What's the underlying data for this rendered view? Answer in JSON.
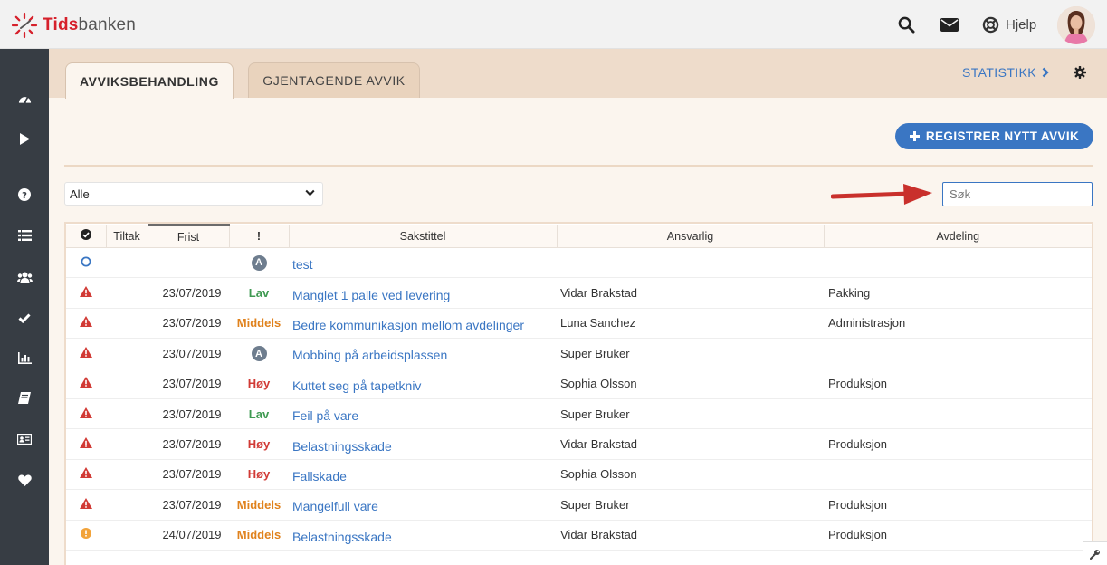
{
  "app": {
    "logo_red": "Tids",
    "logo_grey": "banken"
  },
  "header": {
    "help_label": "Hjelp",
    "icons": [
      "search-icon",
      "mail-icon",
      "lifebuoy-icon"
    ]
  },
  "sidebar": {
    "items": [
      "dashboard-icon",
      "play-icon",
      "question-icon",
      "list-icon",
      "users-icon",
      "check-icon",
      "bar-chart-icon",
      "book-icon",
      "id-card-icon",
      "heart-icon"
    ]
  },
  "tabs": {
    "active": "AVVIKSBEHANDLING",
    "inactive": "GJENTAGENDE AVVIK",
    "statistics": "STATISTIKK"
  },
  "actions": {
    "register": "REGISTRER NYTT AVVIK"
  },
  "filter": {
    "selected": "Alle"
  },
  "search": {
    "placeholder": "Søk"
  },
  "table": {
    "columns": [
      "",
      "Tiltak",
      "Frist",
      "!",
      "Sakstittel",
      "Ansvarlig",
      "Avdeling"
    ],
    "rows": [
      {
        "status": "open",
        "frist": "",
        "prioritet": "A",
        "tittel": "test",
        "ansvarlig": "",
        "avdeling": ""
      },
      {
        "status": "warning",
        "frist": "23/07/2019",
        "prioritet": "Lav",
        "tittel": "Manglet 1 palle ved levering",
        "ansvarlig": "Vidar Brakstad",
        "avdeling": "Pakking"
      },
      {
        "status": "warning",
        "frist": "23/07/2019",
        "prioritet": "Middels",
        "tittel": "Bedre kommunikasjon mellom avdelinger",
        "ansvarlig": "Luna Sanchez",
        "avdeling": "Administrasjon"
      },
      {
        "status": "warning",
        "frist": "23/07/2019",
        "prioritet": "A",
        "tittel": "Mobbing på arbeidsplassen",
        "ansvarlig": "Super Bruker",
        "avdeling": ""
      },
      {
        "status": "warning",
        "frist": "23/07/2019",
        "prioritet": "Høy",
        "tittel": "Kuttet seg på tapetkniv",
        "ansvarlig": "Sophia Olsson",
        "avdeling": "Produksjon"
      },
      {
        "status": "warning",
        "frist": "23/07/2019",
        "prioritet": "Lav",
        "tittel": "Feil på vare",
        "ansvarlig": "Super Bruker",
        "avdeling": ""
      },
      {
        "status": "warning",
        "frist": "23/07/2019",
        "prioritet": "Høy",
        "tittel": "Belastningsskade",
        "ansvarlig": "Vidar Brakstad",
        "avdeling": "Produksjon"
      },
      {
        "status": "warning",
        "frist": "23/07/2019",
        "prioritet": "Høy",
        "tittel": "Fallskade",
        "ansvarlig": "Sophia Olsson",
        "avdeling": ""
      },
      {
        "status": "warning",
        "frist": "23/07/2019",
        "prioritet": "Middels",
        "tittel": "Mangelfull vare",
        "ansvarlig": "Super Bruker",
        "avdeling": "Produksjon"
      },
      {
        "status": "pending",
        "frist": "24/07/2019",
        "prioritet": "Middels",
        "tittel": "Belastningsskade",
        "ansvarlig": "Vidar Brakstad",
        "avdeling": "Produksjon"
      }
    ]
  },
  "colors": {
    "accent": "#3a76c3",
    "brand_red": "#d6202b",
    "sidebar": "#373d44",
    "tabstrip": "#eedccb",
    "priority_low": "#3f9a52",
    "priority_medium": "#e0821d",
    "priority_high": "#d13a35"
  }
}
